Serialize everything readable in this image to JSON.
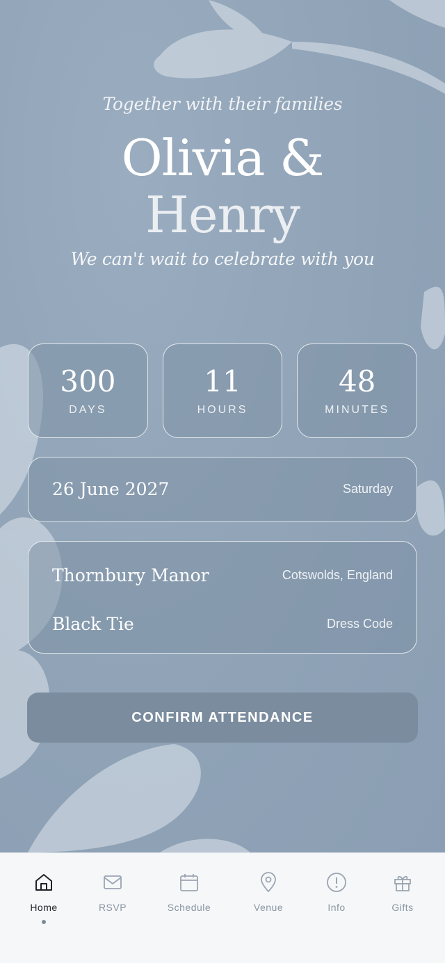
{
  "colors": {
    "background": "#94a6ba",
    "card_fill": "#7d91a6",
    "cta": "#7a8c9e",
    "tabbar": "#f6f7f9",
    "tab_active": "#1e2329",
    "tab_inactive": "#8a96a3"
  },
  "hero": {
    "tagline": "Together with their families",
    "name_line1": "Olivia &",
    "name_line2": "Henry",
    "subline": "We can't wait to celebrate with you"
  },
  "countdown": [
    {
      "value": "300",
      "unit": "DAYS"
    },
    {
      "value": "11",
      "unit": "HOURS"
    },
    {
      "value": "48",
      "unit": "MINUTES"
    }
  ],
  "date_card": {
    "date": "26 June 2027",
    "weekday": "Saturday"
  },
  "venue_card": {
    "venue": "Thornbury Manor",
    "location": "Cotswolds, England",
    "dress_code_value": "Black Tie",
    "dress_code_label": "Dress Code"
  },
  "cta": {
    "label": "CONFIRM ATTENDANCE"
  },
  "tabs": [
    {
      "label": "Home",
      "icon": "home-icon",
      "active": true
    },
    {
      "label": "RSVP",
      "icon": "mail-icon",
      "active": false
    },
    {
      "label": "Schedule",
      "icon": "calendar-icon",
      "active": false
    },
    {
      "label": "Venue",
      "icon": "map-pin-icon",
      "active": false
    },
    {
      "label": "Info",
      "icon": "info-icon",
      "active": false
    },
    {
      "label": "Gifts",
      "icon": "gift-icon",
      "active": false
    }
  ]
}
